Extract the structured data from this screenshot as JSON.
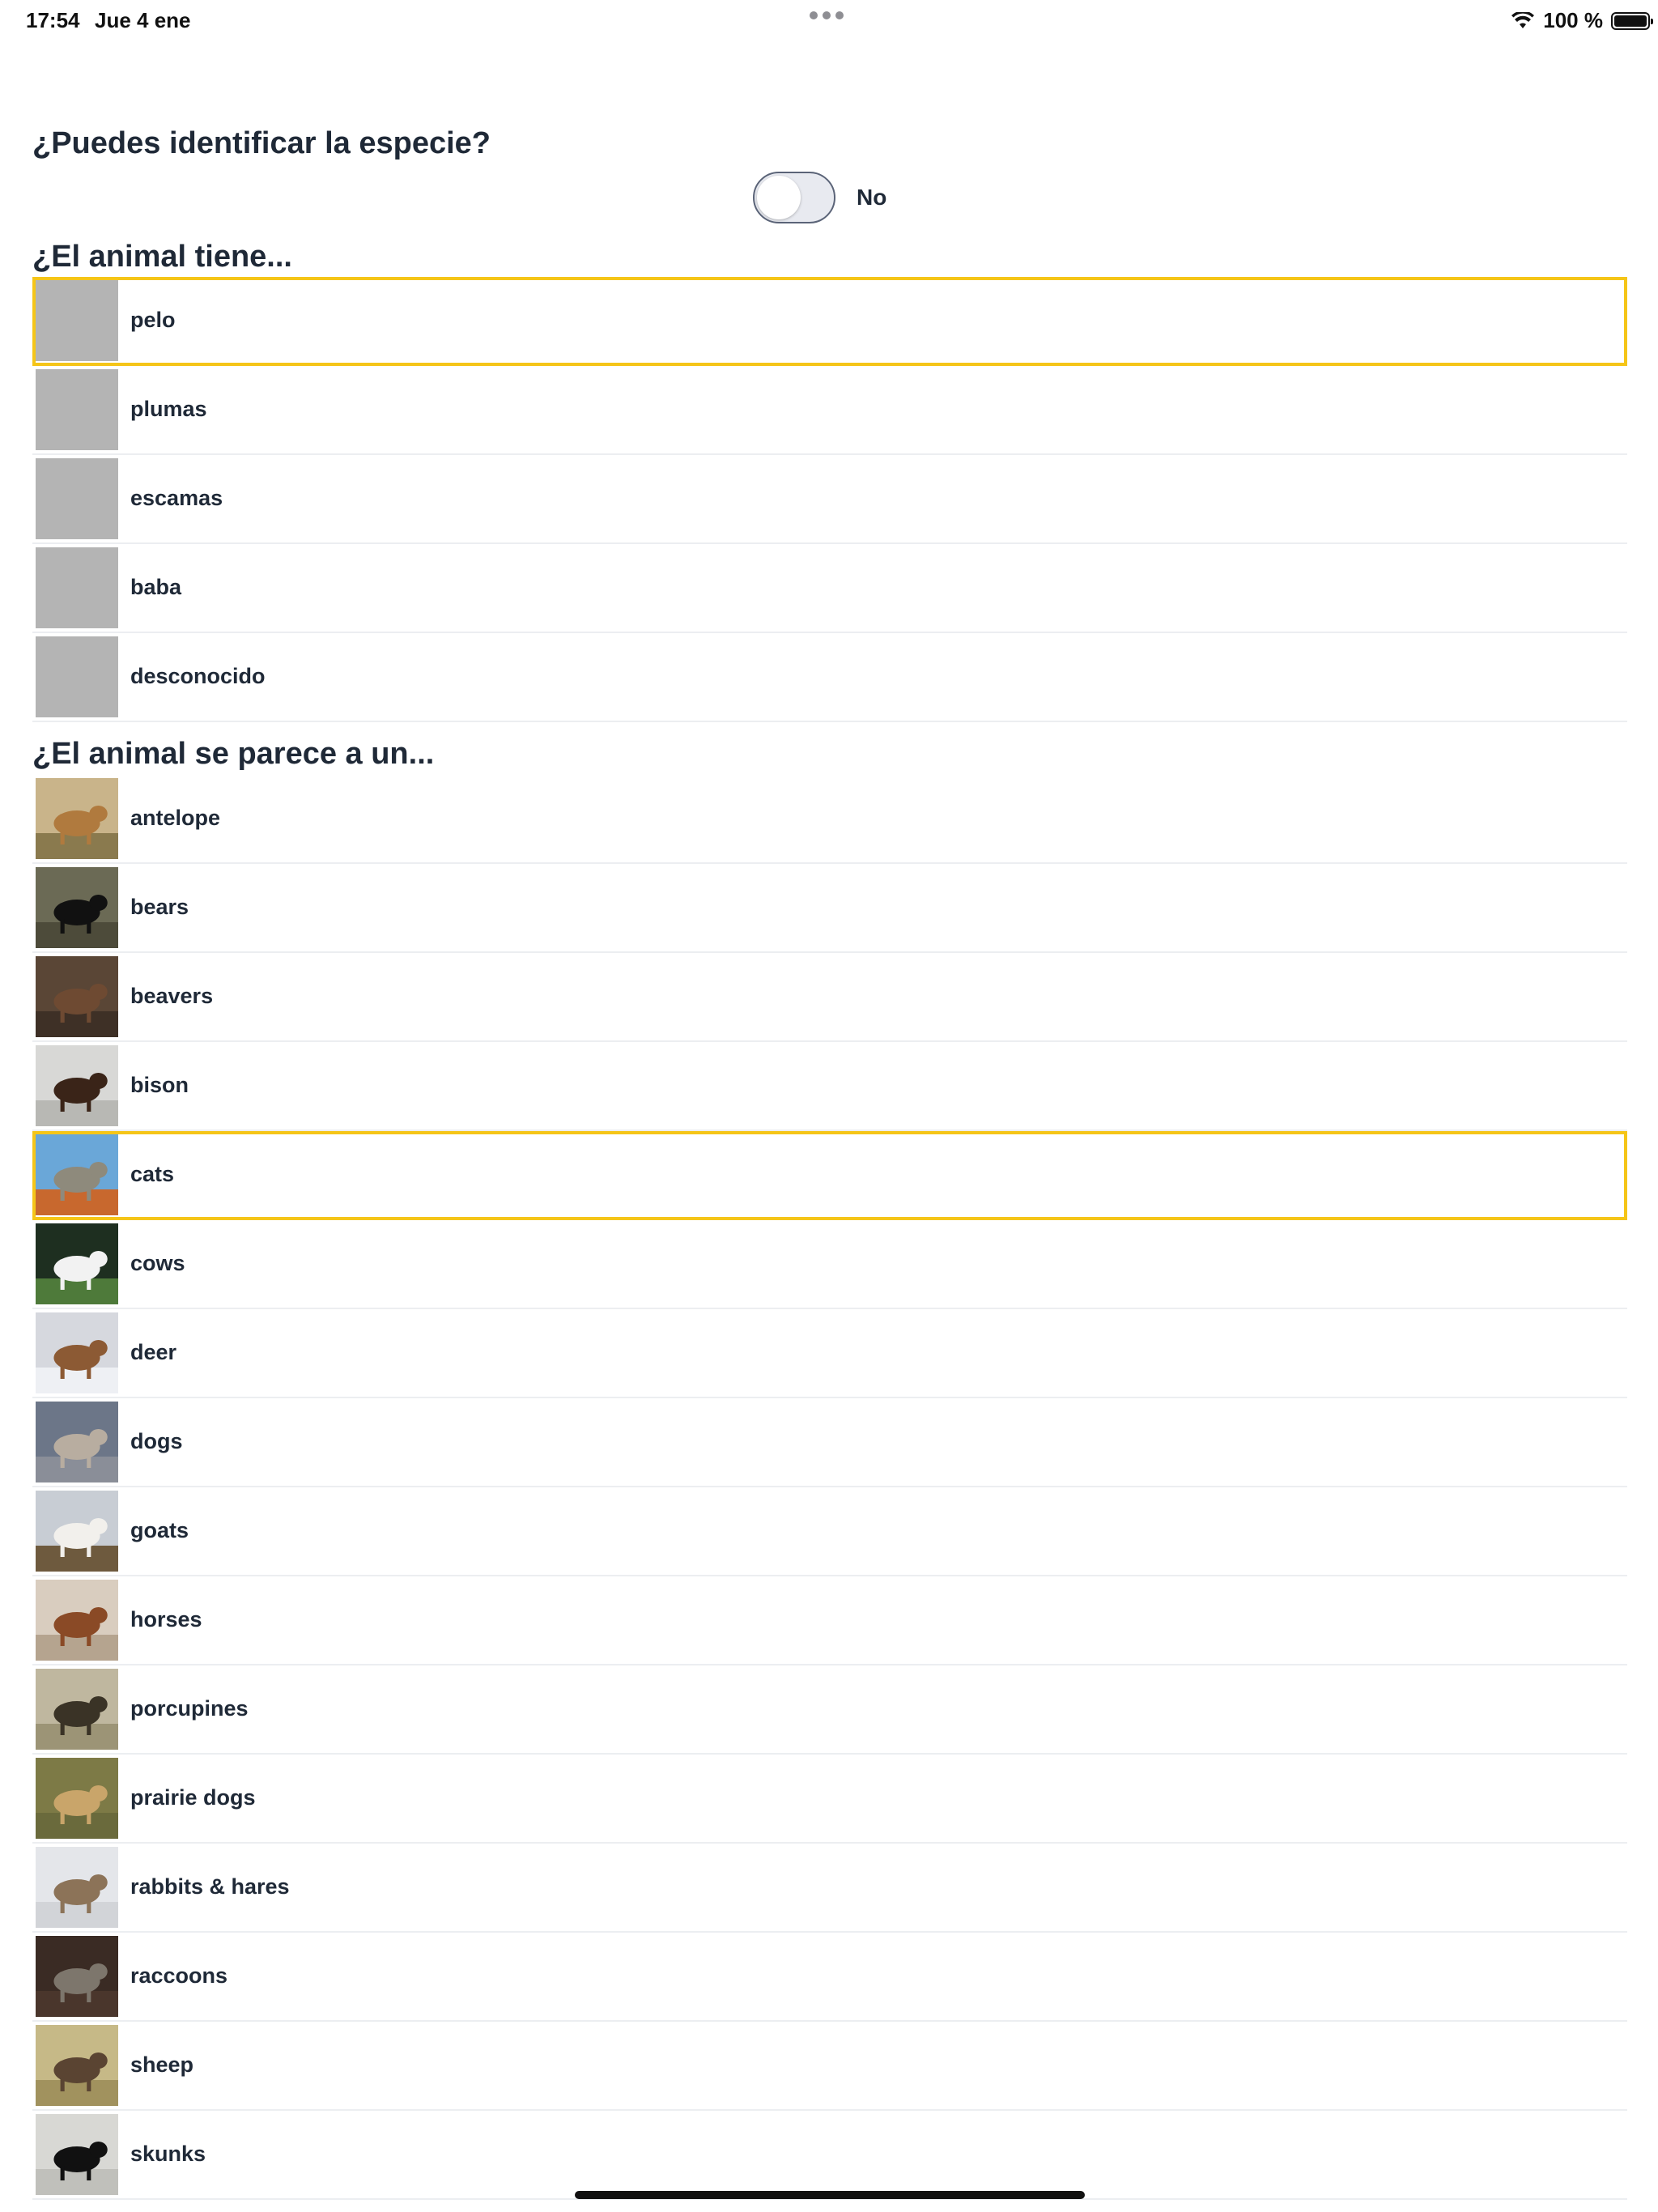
{
  "status_bar": {
    "time": "17:54",
    "date": "Jue 4 ene",
    "battery": "100 %"
  },
  "question": {
    "title": "¿Puedes identificar la especie?",
    "toggle_label": "No",
    "toggle_on": false
  },
  "covering": {
    "title": "¿El animal tiene...",
    "items": [
      {
        "label": "pelo",
        "selected": true
      },
      {
        "label": "plumas",
        "selected": false
      },
      {
        "label": "escamas",
        "selected": false
      },
      {
        "label": "baba",
        "selected": false
      },
      {
        "label": "desconocido",
        "selected": false
      }
    ]
  },
  "resembles": {
    "title": "¿El animal se parece a un...",
    "items": [
      {
        "label": "antelope",
        "icon": "antelope-photo",
        "selected": false
      },
      {
        "label": "bears",
        "icon": "bear-photo",
        "selected": false
      },
      {
        "label": "beavers",
        "icon": "beaver-photo",
        "selected": false
      },
      {
        "label": "bison",
        "icon": "bison-photo",
        "selected": false
      },
      {
        "label": "cats",
        "icon": "cat-photo",
        "selected": true
      },
      {
        "label": "cows",
        "icon": "cow-photo",
        "selected": false
      },
      {
        "label": "deer",
        "icon": "deer-photo",
        "selected": false
      },
      {
        "label": "dogs",
        "icon": "dog-photo",
        "selected": false
      },
      {
        "label": "goats",
        "icon": "goat-photo",
        "selected": false
      },
      {
        "label": "horses",
        "icon": "horse-photo",
        "selected": false
      },
      {
        "label": "porcupines",
        "icon": "porcupine-photo",
        "selected": false
      },
      {
        "label": "prairie dogs",
        "icon": "prairie-dog-photo",
        "selected": false
      },
      {
        "label": "rabbits & hares",
        "icon": "rabbit-photo",
        "selected": false
      },
      {
        "label": "raccoons",
        "icon": "raccoon-photo",
        "selected": false
      },
      {
        "label": "sheep",
        "icon": "sheep-photo",
        "selected": false
      },
      {
        "label": "skunks",
        "icon": "skunk-photo",
        "selected": false
      }
    ]
  },
  "colors": {
    "selection": "#f5c518",
    "placeholder": "#b4b4b4",
    "text": "#1f2937"
  }
}
